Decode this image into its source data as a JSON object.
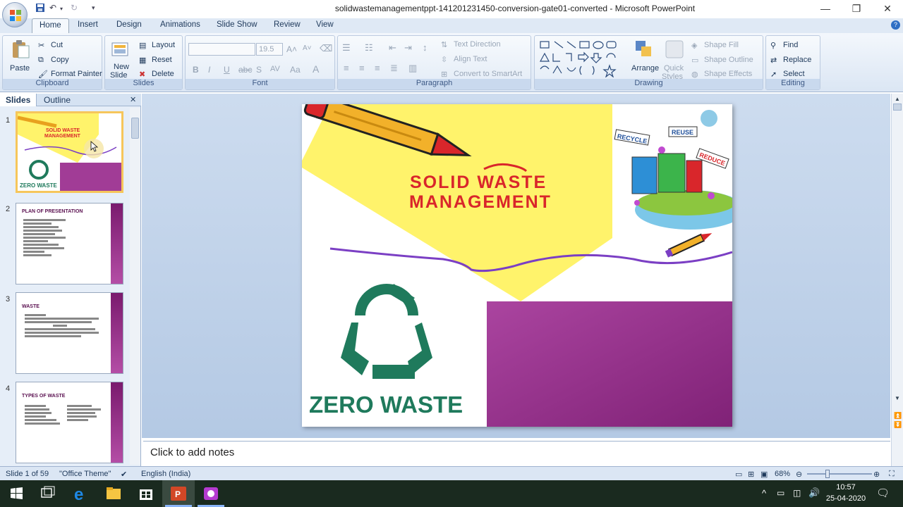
{
  "window": {
    "title": "solidwastemanagementppt-141201231450-conversion-gate01-converted - Microsoft PowerPoint",
    "minimize": "—",
    "restore": "❐",
    "close": "✕"
  },
  "ribbon_tabs": [
    "Home",
    "Insert",
    "Design",
    "Animations",
    "Slide Show",
    "Review",
    "View"
  ],
  "clipboard": {
    "paste": "Paste",
    "cut": "Cut",
    "copy": "Copy",
    "format_painter": "Format Painter",
    "label": "Clipboard"
  },
  "slides_group": {
    "new_slide_line1": "New",
    "new_slide_line2": "Slide",
    "layout": "Layout",
    "reset": "Reset",
    "delete": "Delete",
    "label": "Slides"
  },
  "font_group": {
    "font_name": "",
    "font_size": "19.5",
    "label": "Font"
  },
  "paragraph_group": {
    "text_direction": "Text Direction",
    "align_text": "Align Text",
    "convert_smartart": "Convert to SmartArt",
    "label": "Paragraph"
  },
  "drawing_group": {
    "arrange": "Arrange",
    "quick_styles_line1": "Quick",
    "quick_styles_line2": "Styles",
    "shape_fill": "Shape Fill",
    "shape_outline": "Shape Outline",
    "shape_effects": "Shape Effects",
    "label": "Drawing"
  },
  "editing_group": {
    "find": "Find",
    "replace": "Replace",
    "select": "Select",
    "label": "Editing"
  },
  "pane": {
    "tab_slides": "Slides",
    "tab_outline": "Outline",
    "thumbnails": [
      {
        "num": "1",
        "title": "",
        "sub": ""
      },
      {
        "num": "2",
        "title": "PLAN OF PRESENTATION",
        "sub": ""
      },
      {
        "num": "3",
        "title": "WASTE",
        "sub": ""
      },
      {
        "num": "4",
        "title": "TYPES OF WASTE",
        "sub": ""
      }
    ]
  },
  "slide": {
    "title_line1": "SOLID WASTE",
    "title_line2": "MANAGEMENT",
    "zero_waste": "ZERO WASTE",
    "recycle": "RECYCLE",
    "reuse": "REUSE",
    "reduce": "REDUCE"
  },
  "notes": {
    "placeholder": "Click to add notes"
  },
  "status": {
    "slide_info": "Slide 1 of 59",
    "theme": "\"Office Theme\"",
    "language": "English (India)",
    "zoom": "68%"
  },
  "taskbar": {
    "time": "10:57",
    "date": "25-04-2020"
  },
  "colors": {
    "ribbon_blue": "#dbe6f4",
    "slide_purple": "#a13c96",
    "zero_green": "#1f7a5c",
    "title_red": "#d9262b",
    "yellow": "#fff36b"
  }
}
